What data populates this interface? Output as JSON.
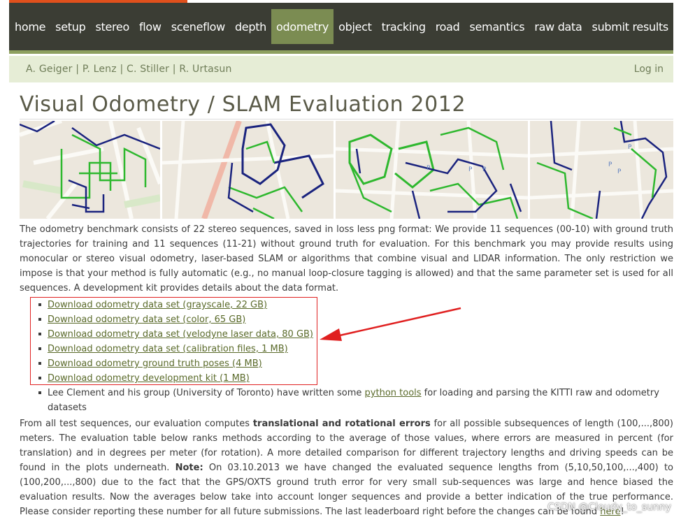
{
  "nav": {
    "items": [
      "home",
      "setup",
      "stereo",
      "flow",
      "sceneflow",
      "depth",
      "odometry",
      "object",
      "tracking",
      "road",
      "semantics",
      "raw data",
      "submit results"
    ],
    "active": "odometry"
  },
  "subbar": {
    "authors": "A. Geiger | P. Lenz | C. Stiller | R. Urtasun",
    "login": "Log in"
  },
  "title": "Visual Odometry / SLAM Evaluation 2012",
  "intro": "The odometry benchmark consists of 22 stereo sequences, saved in loss less png format: We provide 11 sequences (00-10) with ground truth trajectories for training and 11 sequences (11-21) without ground truth for evaluation. For this benchmark you may provide results using monocular or stereo visual odometry, laser-based SLAM or algorithms that combine visual and LIDAR information. The only restriction we impose is that your method is fully automatic (e.g., no manual loop-closure tagging is allowed) and that the same parameter set is used for all sequences. A development kit provides details about the data format.",
  "downloads": [
    "Download odometry data set (grayscale, 22 GB)",
    "Download odometry data set (color, 65 GB)",
    "Download odometry data set (velodyne laser data, 80 GB)",
    "Download odometry data set (calibration files, 1 MB)",
    "Download odometry ground truth poses (4 MB)",
    "Download odometry development kit (1 MB)"
  ],
  "tools_item": {
    "before": "Lee Clement and his group (University of Toronto) have written some ",
    "link": "python tools",
    "after": " for loading and parsing the KITTI raw and odometry datasets"
  },
  "para2": {
    "t1": "From all test sequences, our evaluation computes ",
    "bold1": "translational and rotational errors",
    "t2": " for all possible subsequences of length (100,...,800) meters. The evaluation table below ranks methods according to the average of those values, where errors are measured in percent (for translation) and in degrees per meter (for rotation). A more detailed comparison for different trajectory lengths and driving speeds can be found in the plots underneath. ",
    "bold2": "Note:",
    "t3": " On 03.10.2013 we have changed the evaluated sequence lengths from (5,10,50,100,...,400) to (100,200,...,800) due to the fact that the GPS/OXTS ground truth error for very small sub-sequences was large and hence biased the evaluation results. Now the averages below take into account longer sequences and provide a better indication of the true performance. Please consider reporting these number for all future submissions. The last leaderboard right before the changes can be found ",
    "link": "here",
    "t4": "!"
  },
  "watermark": "CSDN @Cloudy_to_sunny",
  "colors": {
    "nav_bg": "#3b3d34",
    "nav_active": "#7b8c52",
    "accent": "#e0501c",
    "link": "#5a6a2a",
    "trajectory_gt": "#1a237e",
    "trajectory_est": "#2eb82e",
    "annotation": "#e02020"
  }
}
